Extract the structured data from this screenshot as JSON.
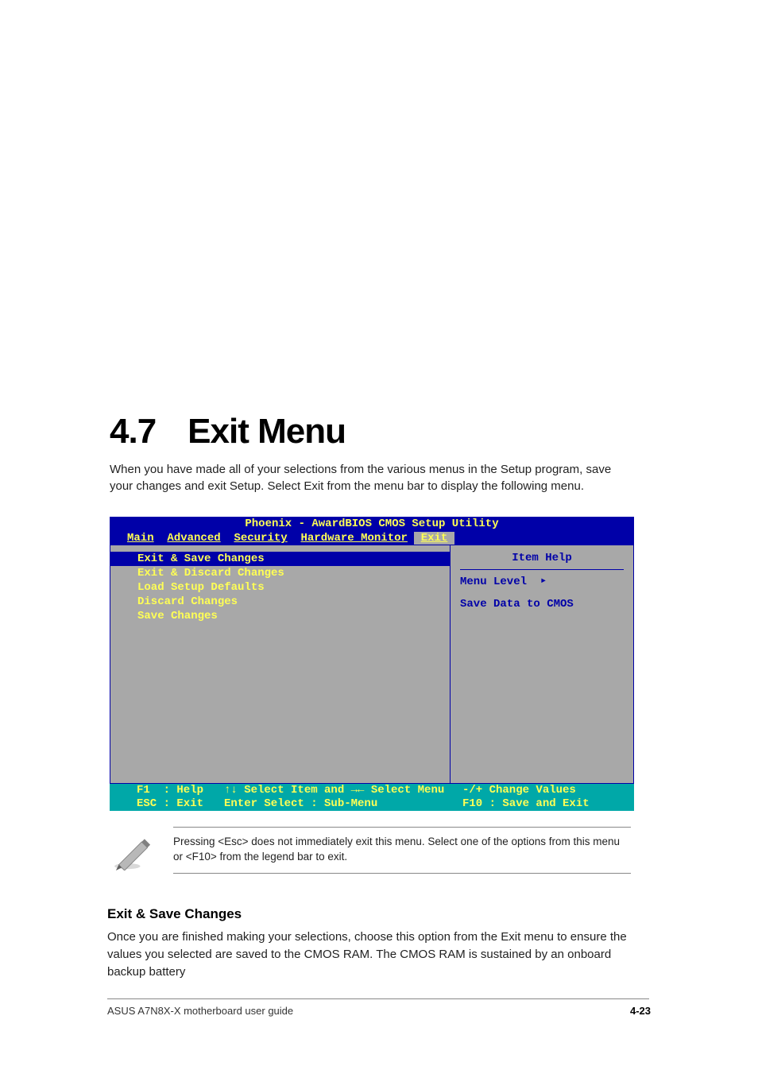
{
  "heading": {
    "number": "4.7",
    "title": "Exit Menu"
  },
  "intro": "When you have made all of your selections from the various menus in the Setup program, save your changes and exit Setup. Select Exit from the menu bar to display the following menu.",
  "bios": {
    "title": "Phoenix - AwardBIOS CMOS Setup Utility",
    "tabs": [
      "Main",
      "Advanced",
      "Security",
      "Hardware Monitor",
      "Exit"
    ],
    "active_tab": "Exit",
    "items": [
      "Exit & Save Changes",
      "Exit & Discard Changes",
      "Load Setup Defaults",
      "Discard Changes",
      "Save Changes"
    ],
    "selected_index": 0,
    "help": {
      "header": "Item Help",
      "menu_level_label": "Menu Level",
      "description": "Save Data to CMOS"
    },
    "footer": {
      "f1": "F1  : Help",
      "selitem": "↑↓ Select Item and →← Select Menu",
      "change": "-/+ Change Values",
      "esc": "ESC : Exit",
      "enter": "Enter Select : Sub-Menu",
      "f10": "F10 : Save and Exit"
    }
  },
  "note": "Pressing <Esc> does not immediately exit this menu. Select one of the options from this menu or <F10> from the legend bar to exit.",
  "section": {
    "title": "Exit & Save Changes",
    "body": "Once you are finished making your selections, choose this option from the Exit menu to ensure the values you selected are saved to the CMOS RAM. The CMOS RAM is sustained by an onboard backup battery"
  },
  "footer": {
    "left": "ASUS A7N8X-X motherboard user guide",
    "right": "4-23"
  }
}
